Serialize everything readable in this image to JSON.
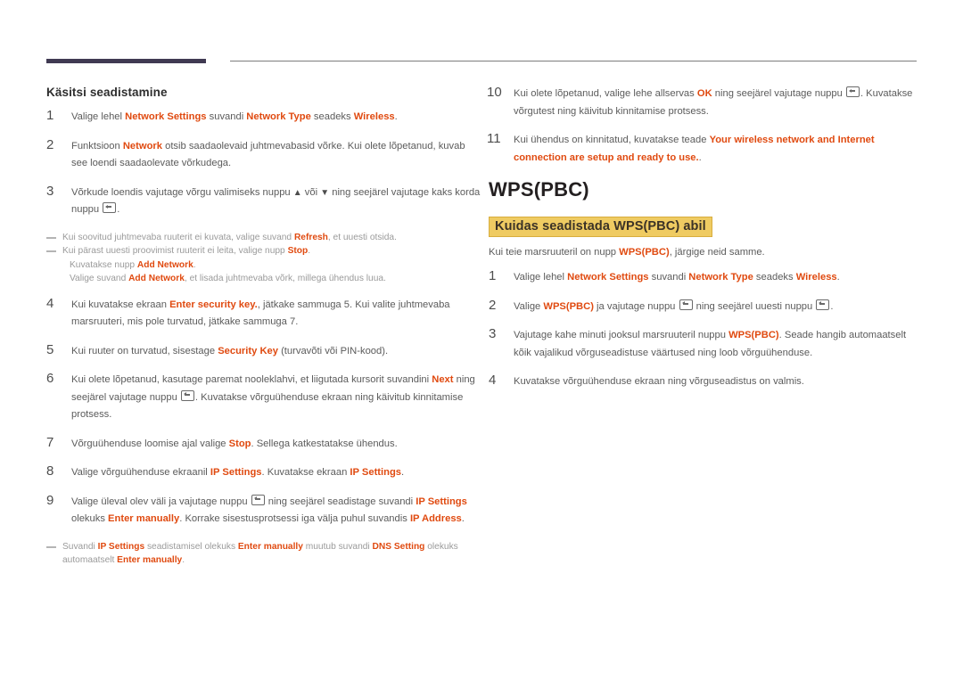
{
  "accent_color": "#e04a10",
  "rule_color": "#403a52",
  "highlight_color": "#efcb62",
  "left_column": {
    "heading": "Käsitsi seadistamine",
    "steps": [
      {
        "num": "1",
        "parts": [
          {
            "t": "Valige lehel ",
            "s": "n"
          },
          {
            "t": "Network Settings",
            "s": "b"
          },
          {
            "t": " suvandi ",
            "s": "n"
          },
          {
            "t": "Network Type",
            "s": "b"
          },
          {
            "t": " seadeks ",
            "s": "n"
          },
          {
            "t": "Wireless",
            "s": "b"
          },
          {
            "t": ".",
            "s": "n"
          }
        ]
      },
      {
        "num": "2",
        "parts": [
          {
            "t": "Funktsioon ",
            "s": "n"
          },
          {
            "t": "Network",
            "s": "b"
          },
          {
            "t": " otsib saadaolevaid juhtmevabasid võrke. Kui olete lõpetanud, kuvab see loendi saadaolevate võrkudega.",
            "s": "n"
          }
        ]
      },
      {
        "num": "3",
        "parts": [
          {
            "t": "Võrkude loendis vajutage võrgu valimiseks nuppu ",
            "s": "n"
          },
          {
            "t": "▲",
            "s": "tri"
          },
          {
            "t": " või ",
            "s": "n"
          },
          {
            "t": "▼",
            "s": "tri"
          },
          {
            "t": " ning seejärel vajutage kaks korda nuppu ",
            "s": "n"
          },
          {
            "t": "",
            "s": "enter"
          },
          {
            "t": ".",
            "s": "n"
          }
        ]
      },
      {
        "num": "4",
        "parts": [
          {
            "t": "Kui kuvatakse ekraan ",
            "s": "n"
          },
          {
            "t": "Enter security key.",
            "s": "b"
          },
          {
            "t": ", jätkake sammuga 5. Kui valite juhtmevaba marsruuteri, mis pole turvatud, jätkake sammuga 7.",
            "s": "n"
          }
        ]
      },
      {
        "num": "5",
        "parts": [
          {
            "t": "Kui ruuter on turvatud, sisestage ",
            "s": "n"
          },
          {
            "t": "Security Key",
            "s": "b"
          },
          {
            "t": " (turvavõti või PIN-kood).",
            "s": "n"
          }
        ]
      },
      {
        "num": "6",
        "parts": [
          {
            "t": "Kui olete lõpetanud, kasutage paremat nooleklahvi, et liigutada kursorit suvandini ",
            "s": "n"
          },
          {
            "t": "Next",
            "s": "b"
          },
          {
            "t": " ning seejärel vajutage nuppu ",
            "s": "n"
          },
          {
            "t": "",
            "s": "enter"
          },
          {
            "t": ". Kuvatakse võrguühenduse ekraan ning käivitub kinnitamise protsess.",
            "s": "n"
          }
        ]
      },
      {
        "num": "7",
        "parts": [
          {
            "t": "Võrguühenduse loomise ajal valige ",
            "s": "n"
          },
          {
            "t": "Stop",
            "s": "b"
          },
          {
            "t": ". Sellega katkestatakse ühendus.",
            "s": "n"
          }
        ]
      },
      {
        "num": "8",
        "parts": [
          {
            "t": "Valige võrguühenduse ekraanil ",
            "s": "n"
          },
          {
            "t": "IP Settings",
            "s": "b"
          },
          {
            "t": ". Kuvatakse ekraan ",
            "s": "n"
          },
          {
            "t": "IP Settings",
            "s": "b"
          },
          {
            "t": ".",
            "s": "n"
          }
        ]
      },
      {
        "num": "9",
        "parts": [
          {
            "t": "Valige üleval olev väli ja vajutage nuppu ",
            "s": "n"
          },
          {
            "t": "",
            "s": "enter"
          },
          {
            "t": " ning seejärel seadistage suvandi ",
            "s": "n"
          },
          {
            "t": "IP Settings",
            "s": "b"
          },
          {
            "t": " olekuks ",
            "s": "n"
          },
          {
            "t": "Enter manually",
            "s": "b"
          },
          {
            "t": ". Korrake sisestusprotsessi iga välja puhul suvandis ",
            "s": "n"
          },
          {
            "t": "IP Address",
            "s": "b"
          },
          {
            "t": ".",
            "s": "n"
          }
        ]
      }
    ],
    "notes_after_step3": [
      {
        "cont": false,
        "parts": [
          {
            "t": "Kui soovitud juhtmevaba ruuterit ei kuvata, valige suvand ",
            "s": "n"
          },
          {
            "t": "Refresh",
            "s": "b"
          },
          {
            "t": ", et uuesti otsida.",
            "s": "n"
          }
        ]
      },
      {
        "cont": false,
        "parts": [
          {
            "t": "Kui pärast uuesti proovimist ruuterit ei leita, valige nupp ",
            "s": "n"
          },
          {
            "t": "Stop",
            "s": "b"
          },
          {
            "t": ".",
            "s": "n"
          }
        ]
      },
      {
        "cont": true,
        "parts": [
          {
            "t": "Kuvatakse nupp ",
            "s": "n"
          },
          {
            "t": "Add Network",
            "s": "b"
          },
          {
            "t": ".",
            "s": "n"
          }
        ]
      },
      {
        "cont": true,
        "parts": [
          {
            "t": "Valige suvand ",
            "s": "n"
          },
          {
            "t": "Add Network",
            "s": "b"
          },
          {
            "t": ", et lisada juhtmevaba võrk, millega ühendus luua.",
            "s": "n"
          }
        ]
      }
    ],
    "notes_after_step9": [
      {
        "cont": false,
        "parts": [
          {
            "t": "Suvandi ",
            "s": "n"
          },
          {
            "t": "IP Settings",
            "s": "b"
          },
          {
            "t": " seadistamisel olekuks ",
            "s": "n"
          },
          {
            "t": "Enter manually",
            "s": "b"
          },
          {
            "t": " muutub suvandi ",
            "s": "n"
          },
          {
            "t": "DNS Setting",
            "s": "b"
          },
          {
            "t": " olekuks automaatselt ",
            "s": "n"
          },
          {
            "t": "Enter manually",
            "s": "b"
          },
          {
            "t": ".",
            "s": "n"
          }
        ]
      }
    ]
  },
  "right_column": {
    "steps_continued": [
      {
        "num": "10",
        "parts": [
          {
            "t": "Kui olete lõpetanud, valige lehe allservas ",
            "s": "n"
          },
          {
            "t": "OK",
            "s": "b"
          },
          {
            "t": " ning seejärel vajutage nuppu ",
            "s": "n"
          },
          {
            "t": "",
            "s": "enter"
          },
          {
            "t": ". Kuvatakse võrgutest ning käivitub kinnitamise protsess.",
            "s": "n"
          }
        ]
      },
      {
        "num": "11",
        "parts": [
          {
            "t": "Kui ühendus on kinnitatud, kuvatakse teade ",
            "s": "n"
          },
          {
            "t": "Your wireless network and Internet connection are setup and ready to use.",
            "s": "b"
          },
          {
            "t": ".",
            "s": "n"
          }
        ]
      }
    ],
    "section_title": "WPS(PBC)",
    "sub_heading": "Kuidas seadistada WPS(PBC) abil",
    "intro": [
      {
        "t": "Kui teie marsruuteril on nupp ",
        "s": "n"
      },
      {
        "t": "WPS(PBC)",
        "s": "b"
      },
      {
        "t": ", järgige neid samme.",
        "s": "n"
      }
    ],
    "steps": [
      {
        "num": "1",
        "parts": [
          {
            "t": "Valige lehel ",
            "s": "n"
          },
          {
            "t": "Network Settings",
            "s": "b"
          },
          {
            "t": " suvandi ",
            "s": "n"
          },
          {
            "t": "Network Type",
            "s": "b"
          },
          {
            "t": " seadeks ",
            "s": "n"
          },
          {
            "t": "Wireless",
            "s": "b"
          },
          {
            "t": ".",
            "s": "n"
          }
        ]
      },
      {
        "num": "2",
        "parts": [
          {
            "t": "Valige ",
            "s": "n"
          },
          {
            "t": "WPS(PBC)",
            "s": "b"
          },
          {
            "t": " ja vajutage nuppu ",
            "s": "n"
          },
          {
            "t": "",
            "s": "enter"
          },
          {
            "t": " ning seejärel uuesti nuppu ",
            "s": "n"
          },
          {
            "t": "",
            "s": "enter"
          },
          {
            "t": ".",
            "s": "n"
          }
        ]
      },
      {
        "num": "3",
        "parts": [
          {
            "t": "Vajutage kahe minuti jooksul marsruuteril nuppu ",
            "s": "n"
          },
          {
            "t": "WPS(PBC)",
            "s": "b"
          },
          {
            "t": ". Seade hangib automaatselt kõik vajalikud võrguseadistuse väärtused ning loob võrguühenduse.",
            "s": "n"
          }
        ]
      },
      {
        "num": "4",
        "parts": [
          {
            "t": "Kuvatakse võrguühenduse ekraan ning võrguseadistus on valmis.",
            "s": "n"
          }
        ]
      }
    ]
  }
}
